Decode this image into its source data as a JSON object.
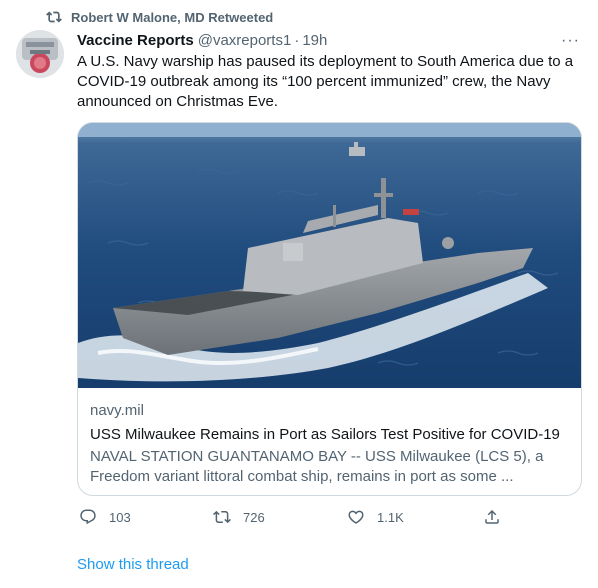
{
  "retweet_banner": {
    "text": "Robert W Malone, MD Retweeted",
    "icon": "retweet-icon"
  },
  "tweet": {
    "author_name": "Vaccine Reports",
    "author_handle": "@vaxreports1",
    "separator": "·",
    "timestamp": "19h",
    "more_icon": "more-horizontal-icon",
    "text": "A U.S. Navy warship has paused its deployment to South America due to a COVID-19 outbreak among its “100 percent immunized” crew, the Navy announced on Christmas Eve."
  },
  "link_card": {
    "domain": "navy.mil",
    "title": "USS Milwaukee Remains in Port as Sailors Test Positive for COVID-19",
    "description": "NAVAL STATION GUANTANAMO BAY -- USS Milwaukee (LCS 5), a Freedom variant littoral combat ship, remains in port as some ..."
  },
  "actions": {
    "reply_count": "103",
    "retweet_count": "726",
    "like_count": "1.1K"
  },
  "show_thread": "Show this thread",
  "colors": {
    "accent": "#1d9bf0",
    "muted": "#536471",
    "text": "#0f1419",
    "border": "#cfd9de"
  }
}
